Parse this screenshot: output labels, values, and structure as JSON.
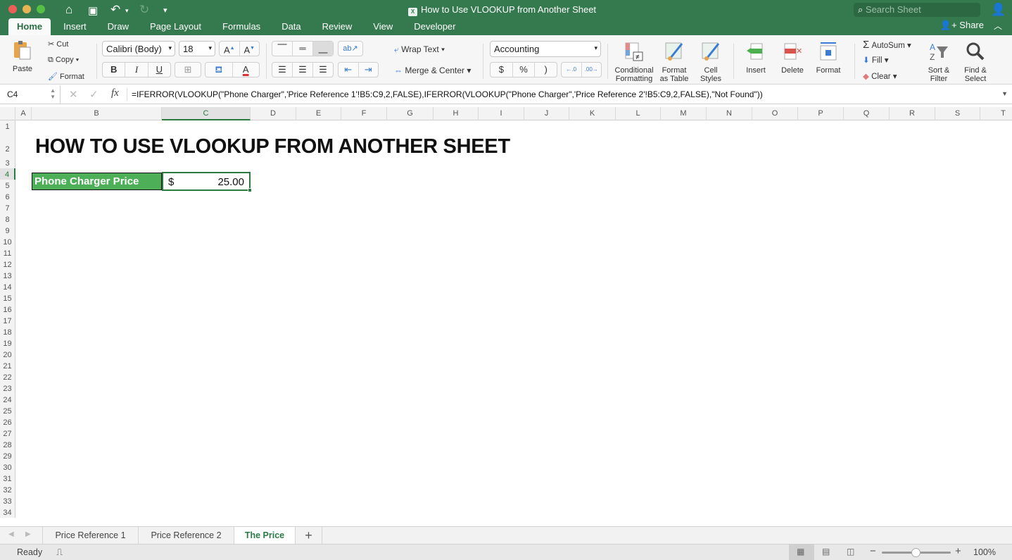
{
  "window": {
    "title": "How to Use VLOOKUP from Another Sheet",
    "search_placeholder": "Search Sheet",
    "share_label": "Share"
  },
  "ribbon_tabs": [
    "Home",
    "Insert",
    "Draw",
    "Page Layout",
    "Formulas",
    "Data",
    "Review",
    "View",
    "Developer"
  ],
  "active_tab": "Home",
  "clipboard": {
    "paste": "Paste",
    "cut": "Cut",
    "copy": "Copy",
    "format": "Format"
  },
  "font": {
    "name": "Calibri (Body)",
    "size": "18",
    "bold": "B",
    "italic": "I",
    "underline": "U"
  },
  "alignment": {
    "wrap_text": "Wrap Text",
    "merge_center": "Merge & Center"
  },
  "number": {
    "format": "Accounting",
    "currency": "$",
    "percent": "%",
    "comma": ")",
    "inc_decimal": ".0 .00",
    "dec_decimal": ".00 .0"
  },
  "styles": {
    "conditional": "Conditional Formatting",
    "format_table": "Format as Table",
    "cell_styles": "Cell Styles"
  },
  "cells_group": {
    "insert": "Insert",
    "delete": "Delete",
    "format": "Format"
  },
  "editing": {
    "autosum": "AutoSum",
    "fill": "Fill",
    "clear": "Clear",
    "sort_filter": "Sort & Filter",
    "find_select": "Find & Select"
  },
  "formula_bar": {
    "name_box": "C4",
    "fx": "fx",
    "formula": "=IFERROR(VLOOKUP(\"Phone Charger\",'Price Reference 1'!B5:C9,2,FALSE),IFERROR(VLOOKUP(\"Phone Charger\",'Price Reference 2'!B5:C9,2,FALSE),\"Not Found\"))"
  },
  "columns": [
    "A",
    "B",
    "C",
    "D",
    "E",
    "F",
    "G",
    "H",
    "I",
    "J",
    "K",
    "L",
    "M",
    "N",
    "O",
    "P",
    "Q",
    "R",
    "S",
    "T"
  ],
  "rows": [
    "1",
    "2",
    "3",
    "4",
    "5",
    "6",
    "7",
    "8",
    "9",
    "10",
    "11",
    "12",
    "13",
    "14",
    "15",
    "16",
    "17",
    "18",
    "19",
    "20",
    "21",
    "22",
    "23",
    "24",
    "25",
    "26",
    "27",
    "28",
    "29",
    "30",
    "31",
    "32",
    "33",
    "34"
  ],
  "sheet": {
    "heading": "HOW TO USE VLOOKUP FROM ANOTHER SHEET",
    "label": "Phone Charger Price",
    "currency": "$",
    "value": "25.00"
  },
  "sheet_tabs": [
    "Price Reference 1",
    "Price Reference 2",
    "The Price"
  ],
  "active_sheet": "The Price",
  "status": {
    "ready": "Ready",
    "zoom": "100%",
    "zoom_level": 0.5
  },
  "colors": {
    "brand": "#347a4e",
    "label_fill": "#4daf57",
    "selection": "#2b7a3f"
  }
}
